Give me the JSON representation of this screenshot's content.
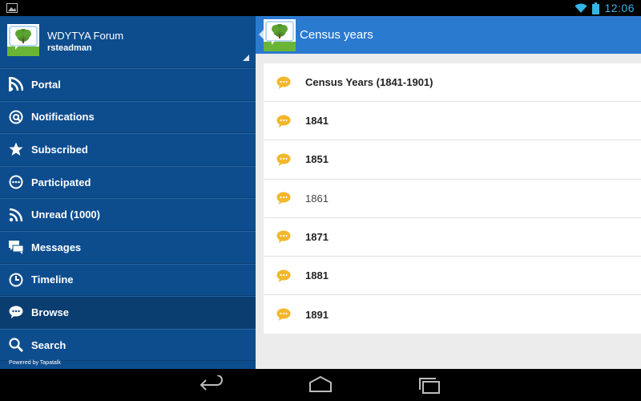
{
  "status_bar": {
    "time": "12:06",
    "icons": [
      "image-notification-icon",
      "wifi-icon",
      "battery-icon"
    ]
  },
  "sidebar": {
    "forum_name": "WDYTYA Forum",
    "username": "rsteadman",
    "items": [
      {
        "label": "Portal",
        "icon": "portal-icon"
      },
      {
        "label": "Notifications",
        "icon": "at-icon"
      },
      {
        "label": "Subscribed",
        "icon": "star-icon"
      },
      {
        "label": "Participated",
        "icon": "participated-icon"
      },
      {
        "label": "Unread (1000)",
        "icon": "rss-icon"
      },
      {
        "label": "Messages",
        "icon": "messages-icon"
      },
      {
        "label": "Timeline",
        "icon": "clock-icon"
      },
      {
        "label": "Browse",
        "icon": "chat-bubble-icon",
        "active": true
      },
      {
        "label": "Search",
        "icon": "search-icon"
      }
    ],
    "powered_by": "Powered by Tapatalk"
  },
  "main": {
    "title": "Census years",
    "rows": [
      {
        "label": "Census Years (1841-1901)",
        "bold": true
      },
      {
        "label": "1841",
        "bold": true
      },
      {
        "label": "1851",
        "bold": true
      },
      {
        "label": "1861",
        "bold": false
      },
      {
        "label": "1871",
        "bold": true
      },
      {
        "label": "1881",
        "bold": true
      },
      {
        "label": "1891",
        "bold": true
      }
    ]
  },
  "colors": {
    "sidebar_bg": "#0d4d8e",
    "topbar_bg": "#2a7ad0",
    "accent_time": "#33b5e5",
    "bubble": "#f3b72c"
  }
}
